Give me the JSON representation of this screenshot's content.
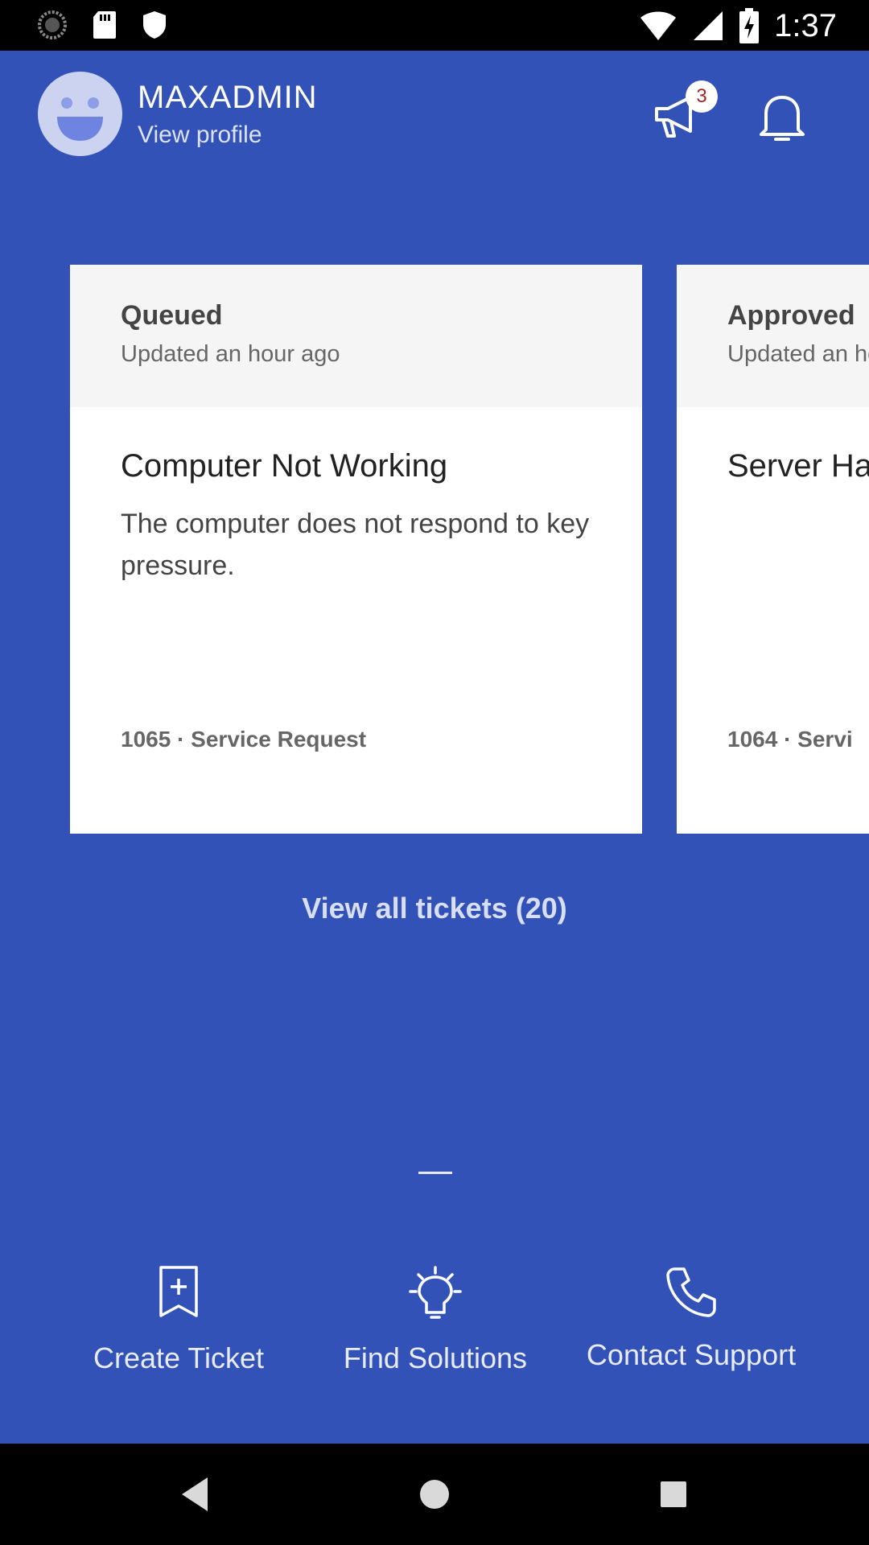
{
  "status_bar": {
    "time": "1:37",
    "left_icons": [
      "loading-icon",
      "sd-card-icon",
      "shield-icon"
    ],
    "right_icons": [
      "wifi-icon",
      "cell-signal-icon",
      "battery-charging-icon"
    ]
  },
  "header": {
    "username": "MAXADMIN",
    "view_profile": "View profile",
    "announcement_count": "3"
  },
  "tickets": [
    {
      "status": "Queued",
      "updated": "Updated an hour ago",
      "title": "Computer Not Working",
      "description": "The computer does not respond to key pressure.",
      "meta": "1065 · Service Request"
    },
    {
      "status": "Approved",
      "updated": "Updated an hour ago",
      "title": "Server Ha",
      "description": "",
      "meta": "1064 · Servi"
    }
  ],
  "view_all": "View all tickets (20)",
  "actions": {
    "create_ticket": "Create Ticket",
    "find_solutions": "Find Solutions",
    "contact_support": "Contact Support"
  },
  "colors": {
    "background": "#3352b8",
    "card_header": "#f5f5f5",
    "badge_text": "#a12525"
  }
}
